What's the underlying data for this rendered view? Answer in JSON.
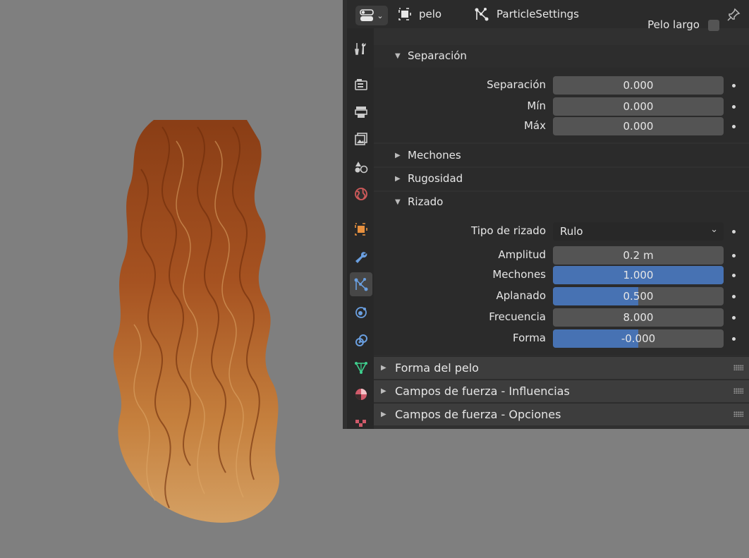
{
  "header": {
    "object_name": "pelo",
    "settings_name": "ParticleSettings"
  },
  "clipped_label": "Pelo largo",
  "sections": {
    "separacion": {
      "title": "Separación",
      "rows": [
        {
          "label": "Separación",
          "value": "0.000"
        },
        {
          "label": "Mín",
          "value": "0.000"
        },
        {
          "label": "Máx",
          "value": "0.000"
        }
      ]
    },
    "mechones": {
      "title": "Mechones"
    },
    "rugosidad": {
      "title": "Rugosidad"
    },
    "rizado": {
      "title": "Rizado",
      "tipo_label": "Tipo de rizado",
      "tipo_value": "Rulo",
      "rows": [
        {
          "label": "Amplitud",
          "value": "0.2 m",
          "fill": 0
        },
        {
          "label": "Mechones",
          "value": "1.000",
          "fill": 1.0
        },
        {
          "label": "Aplanado",
          "value": "0.500",
          "fill": 0.5
        },
        {
          "label": "Frecuencia",
          "value": "8.000",
          "fill": 0
        },
        {
          "label": "Forma",
          "value": "-0.000",
          "fill": 0.5
        }
      ]
    }
  },
  "main_panels": [
    {
      "title": "Forma del pelo"
    },
    {
      "title": "Campos de fuerza - Influencias"
    },
    {
      "title": "Campos de fuerza - Opciones"
    }
  ],
  "colors": {
    "accent": "#4772b3",
    "panel_bg": "#303030",
    "field_bg": "#545454"
  }
}
